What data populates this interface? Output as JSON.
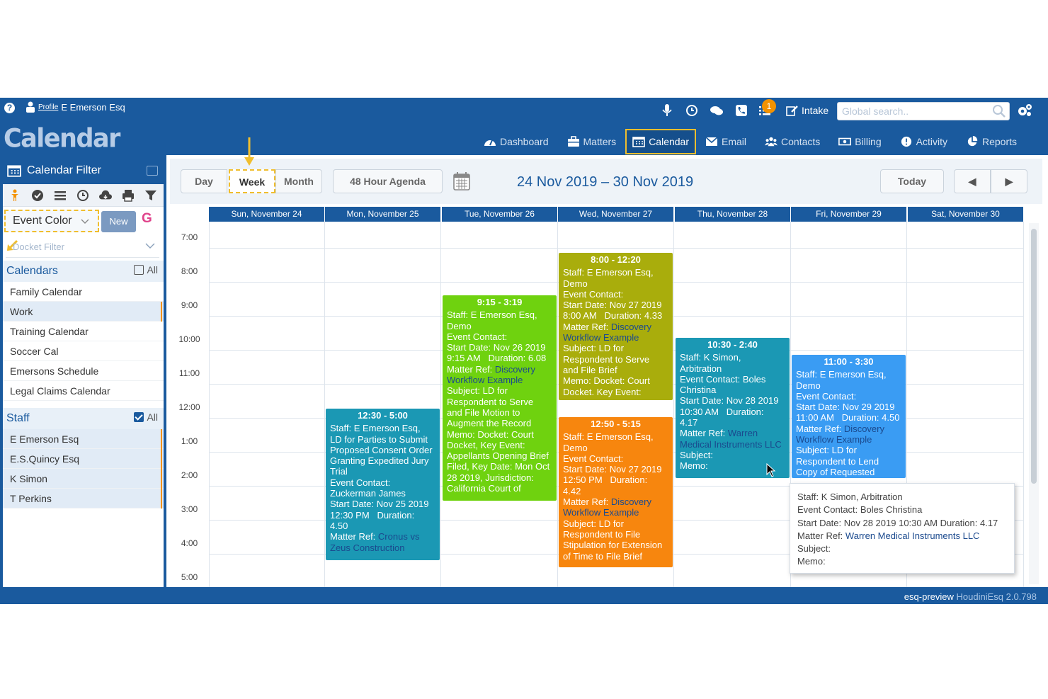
{
  "header": {
    "help_glyph": "?",
    "profile_label": "Profile",
    "user_name": "E Emerson Esq",
    "app_title": "Calendar",
    "notification_count": "1",
    "intake_label": "Intake",
    "search_placeholder": "Global search.."
  },
  "nav": [
    {
      "label": "Dashboard",
      "icon": "dashboard-icon",
      "active": false
    },
    {
      "label": "Matters",
      "icon": "briefcase-icon",
      "active": false
    },
    {
      "label": "Calendar",
      "icon": "calendar-icon",
      "active": true
    },
    {
      "label": "Email",
      "icon": "envelope-icon",
      "active": false
    },
    {
      "label": "Contacts",
      "icon": "users-icon",
      "active": false
    },
    {
      "label": "Billing",
      "icon": "money-icon",
      "active": false
    },
    {
      "label": "Activity",
      "icon": "alert-icon",
      "active": false
    },
    {
      "label": "Reports",
      "icon": "pie-chart-icon",
      "active": false
    }
  ],
  "sidebar": {
    "title": "Calendar Filter",
    "event_color_label": "Event Color",
    "new_button": "New",
    "google_glyph": "G",
    "docket_placeholder": "Docket Filter",
    "calendars_title": "Calendars",
    "all_label": "All",
    "calendars": [
      {
        "label": "Family Calendar",
        "selected": false
      },
      {
        "label": "Work",
        "selected": true
      },
      {
        "label": "Training Calendar",
        "selected": false
      },
      {
        "label": "Soccer Cal",
        "selected": false
      },
      {
        "label": "Emersons Schedule",
        "selected": false
      },
      {
        "label": "Legal Claims Calendar",
        "selected": false
      }
    ],
    "staff_title": "Staff",
    "staff_all_label": "All",
    "staff": [
      "E Emerson Esq",
      "E.S.Quincy Esq",
      "K Simon",
      "T Perkins"
    ]
  },
  "toolbar": {
    "day": "Day",
    "week": "Week",
    "month": "Month",
    "agenda": "48 Hour Agenda",
    "range": "24 Nov 2019 – 30 Nov 2019",
    "today": "Today",
    "prev": "◀",
    "next": "▶"
  },
  "calendar": {
    "days": [
      "Sun, November 24",
      "Mon, November 25",
      "Tue, November 26",
      "Wed, November 27",
      "Thu, November 28",
      "Fri, November 29",
      "Sat, November 30"
    ],
    "times": [
      "7:00",
      "8:00",
      "9:00",
      "10:00",
      "11:00",
      "12:00",
      "1:00",
      "2:00",
      "3:00",
      "4:00",
      "5:00"
    ],
    "events": [
      {
        "time": "12:30 - 5:00",
        "color": "#1b98b4",
        "lines": [
          "Staff: E Emerson Esq,",
          "LD for Parties to Submit",
          "Proposed Consent Order",
          "Granting Expedited Jury",
          "Trial",
          "Event Contact:",
          "Zuckerman James",
          "Start Date: Nov 25 2019",
          "12:30 PM   Duration:",
          "4.50"
        ],
        "matter_label": "Matter Ref: ",
        "matter_link": "Cronus vs",
        "matter_link2": "Zeus Construction"
      },
      {
        "time": "9:15 - 3:19",
        "color": "#6fd20f",
        "lines": [
          "Staff: E Emerson Esq,",
          "Demo",
          "Event Contact:",
          "Start Date: Nov 26 2019",
          "9:15 AM   Duration: 6.08"
        ],
        "matter_label": "Matter Ref: ",
        "matter_link": "Discovery",
        "matter_link2": "Workflow Example",
        "after": [
          "Subject: LD for",
          "Respondent to Serve",
          "and File Motion to",
          "Augment the Record",
          "Memo: Docket: Court",
          "Docket, Key Event:",
          "Appellants Opening Brief",
          "Filed, Key Date: Mon Oct",
          "28 2019, Jurisdiction:",
          "California Court of"
        ]
      },
      {
        "time": "8:00 - 12:20",
        "color": "#a9ad0c",
        "lines": [
          "Staff: E Emerson Esq,",
          "Demo",
          "Event Contact:",
          "Start Date: Nov 27 2019",
          "8:00 AM   Duration: 4.33"
        ],
        "matter_label": "Matter Ref: ",
        "matter_link": "Discovery",
        "matter_link2": "Workflow Example",
        "after": [
          "Subject: LD for",
          "Respondent to Serve",
          "and File Brief",
          "Memo: Docket: Court",
          "Docket. Key Event:"
        ]
      },
      {
        "time": "12:50 - 5:15",
        "color": "#f7860e",
        "lines": [
          "Staff: E Emerson Esq,",
          "Demo",
          "Event Contact:",
          "Start Date: Nov 27 2019",
          "12:50 PM   Duration:",
          "4.42"
        ],
        "matter_label": "Matter Ref: ",
        "matter_link": "Discovery",
        "matter_link2": "Workflow Example",
        "after": [
          "Subject: LD for",
          "Respondent to File",
          "Stipulation for Extension",
          "of Time to File Brief"
        ]
      },
      {
        "time": "10:30 - 2:40",
        "color": "#1b98b4",
        "lines": [
          "Staff: K Simon,",
          "Arbitration",
          "Event Contact: Boles",
          "Christina",
          "Start Date: Nov 28 2019",
          "10:30 AM   Duration:",
          "4.17"
        ],
        "matter_label": "Matter Ref: ",
        "matter_link": "Warren",
        "matter_link2": "Medical Instruments LLC",
        "after": [
          "Subject:",
          "Memo:"
        ]
      },
      {
        "time": "11:00 - 3:30",
        "color": "#3a9cf3",
        "lines": [
          "Staff: E Emerson Esq,",
          "Demo",
          "Event Contact:",
          "Start Date: Nov 29 2019",
          "11:00 AM   Duration: 4.50"
        ],
        "matter_label": "Matter Ref: ",
        "matter_link": "Discovery",
        "matter_link2": "Workflow Example",
        "after": [
          "Subject: LD for",
          "Respondent to Lend",
          "Copy of Requested"
        ]
      }
    ]
  },
  "tooltip": {
    "staff": "Staff: K Simon, Arbitration",
    "contact": "Event Contact: Boles Christina",
    "start": "Start Date: Nov 28 2019 10:30 AM    Duration: 4.17",
    "matter_label": "Matter Ref: ",
    "matter_link": "Warren Medical Instruments LLC",
    "subject": "Subject:",
    "memo": "Memo:"
  },
  "footer": {
    "server": "esq-preview",
    "version": "HoudiniEsq 2.0.798"
  },
  "colors": {
    "brand_blue": "#1a5a9e",
    "highlight_yellow": "#f0be2e",
    "badge_orange": "#f39200"
  }
}
